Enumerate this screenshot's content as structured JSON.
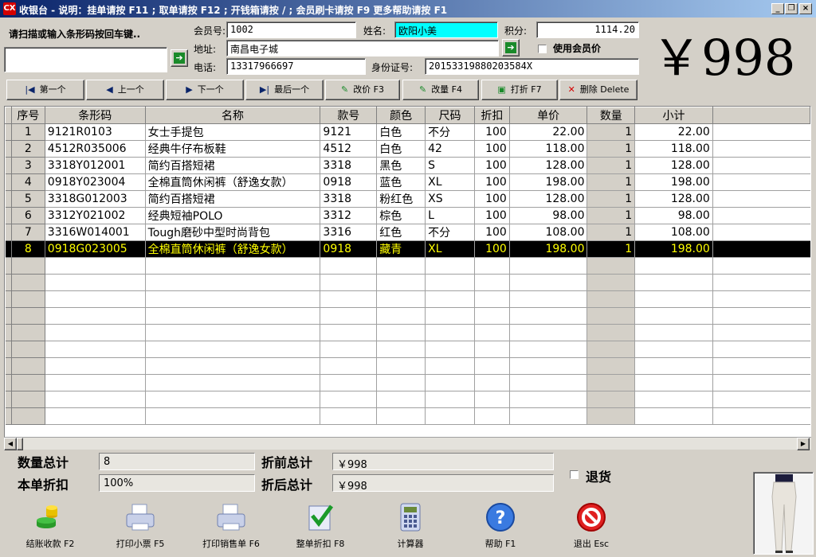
{
  "window": {
    "title": "收银台 - 说明：挂单请按 F11 ; 取单请按 F12 ; 开钱箱请按 / ; 会员刷卡请按 F9   更多帮助请按 F1",
    "app_icon": "CX"
  },
  "scan": {
    "prompt": "请扫描或输入条形码按回车键..",
    "value": ""
  },
  "member": {
    "id_label": "会员号:",
    "id_value": "1002",
    "name_label": "姓名:",
    "name_value": "欧阳小美",
    "points_label": "积分:",
    "points_value": "1114.20",
    "address_label": "地址:",
    "address_value": "南昌电子城",
    "use_member_price_label": "使用会员价",
    "phone_label": "电话:",
    "phone_value": "13317966697",
    "idcard_label": "身份证号:",
    "idcard_value": "20153319880203584X"
  },
  "total_display": "￥998",
  "nav": {
    "first": "第一个",
    "prev": "上一个",
    "next": "下一个",
    "last": "最后一个",
    "change_price": "改价 F3",
    "change_qty": "改量 F4",
    "discount": "打折 F7",
    "delete": "删除 Delete"
  },
  "table": {
    "headers": [
      "序号",
      "条形码",
      "名称",
      "款号",
      "颜色",
      "尺码",
      "折扣",
      "单价",
      "数量",
      "小计"
    ],
    "rows": [
      [
        "1",
        "9121R0103",
        "女士手提包",
        "9121",
        "白色",
        "不分",
        "100",
        "22.00",
        "1",
        "22.00"
      ],
      [
        "2",
        "4512R035006",
        "经典牛仔布板鞋",
        "4512",
        "白色",
        "42",
        "100",
        "118.00",
        "1",
        "118.00"
      ],
      [
        "3",
        "3318Y012001",
        "简约百搭短裙",
        "3318",
        "黑色",
        "S",
        "100",
        "128.00",
        "1",
        "128.00"
      ],
      [
        "4",
        "0918Y023004",
        "全棉直筒休闲裤（舒逸女款）",
        "0918",
        "蓝色",
        "XL",
        "100",
        "198.00",
        "1",
        "198.00"
      ],
      [
        "5",
        "3318G012003",
        "简约百搭短裙",
        "3318",
        "粉红色",
        "XS",
        "100",
        "128.00",
        "1",
        "128.00"
      ],
      [
        "6",
        "3312Y021002",
        "经典短袖POLO",
        "3312",
        "棕色",
        "L",
        "100",
        "98.00",
        "1",
        "98.00"
      ],
      [
        "7",
        "3316W014001",
        "Tough磨砂中型时尚背包",
        "3316",
        "红色",
        "不分",
        "100",
        "108.00",
        "1",
        "108.00"
      ],
      [
        "8",
        "0918G023005",
        "全棉直筒休闲裤（舒逸女款）",
        "0918",
        "藏青",
        "XL",
        "100",
        "198.00",
        "1",
        "198.00"
      ]
    ],
    "selected_row": 8
  },
  "summary": {
    "qty_total_label": "数量总计",
    "qty_total_value": "8",
    "discount_label": "本单折扣",
    "discount_value": "100%",
    "before_total_label": "折前总计",
    "before_total_value": "￥998",
    "after_total_label": "折后总计",
    "after_total_value": "￥998",
    "return_label": "退货"
  },
  "toolbar": {
    "checkout": "结账收款 F2",
    "print_receipt": "打印小票 F5",
    "print_sales": "打印销售单 F6",
    "whole_discount": "整单折扣 F8",
    "calculator": "计算器",
    "help": "帮助 F1",
    "exit": "退出 Esc"
  },
  "colors": {
    "title_start": "#0a246a",
    "title_end": "#a6caf0",
    "name_field_bg": "#00ffff",
    "selected_row_bg": "#000000",
    "selected_row_fg": "#ffff00"
  }
}
